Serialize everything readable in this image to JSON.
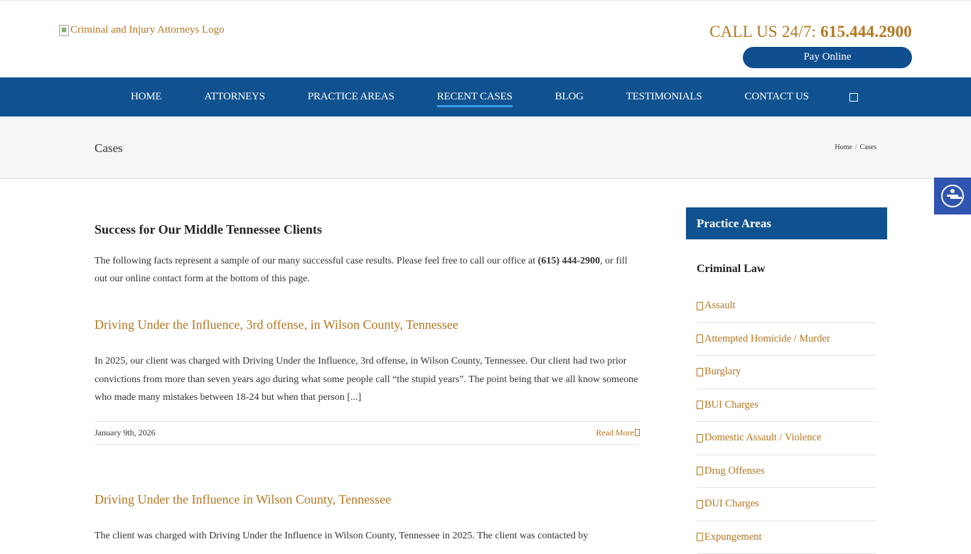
{
  "header": {
    "logo_alt": "Criminal and Injury Attorneys Logo",
    "call_label": "CALL US 24/7:",
    "phone": "615.444.2900",
    "pay_button": "Pay Online"
  },
  "nav": {
    "items": [
      "HOME",
      "ATTORNEYS",
      "PRACTICE AREAS",
      "RECENT CASES",
      "BLOG",
      "TESTIMONIALS",
      "CONTACT US"
    ],
    "active": "RECENT CASES",
    "search_glyph": ""
  },
  "titlebar": {
    "title": "Cases",
    "breadcrumb": [
      "Home",
      "Cases"
    ],
    "separator": "/"
  },
  "main": {
    "heading": "Success for Our Middle Tennessee Clients",
    "intro_before": "The following facts represent a sample of our many successful case results. Please feel free to call our office at ",
    "intro_phone": "(615) 444-2900",
    "intro_after": ", or fill out our online contact form at the bottom of this page.",
    "posts": [
      {
        "title": "Driving Under the Influence, 3rd offense, in Wilson County, Tennessee",
        "excerpt": "In 2025, our client was charged with Driving Under the Influence, 3rd offense, in Wilson County, Tennessee. Our client had two prior convictions from more than seven years ago during what some people call “the stupid years”. The point being that we all know someone who made many mistakes between 18-24 but when that person [...]",
        "date": "January 9th, 2026",
        "read_more": "Read More"
      },
      {
        "title": "Driving Under the Influence in Wilson County, Tennessee",
        "excerpt": "The client was charged with Driving Under the Influence in Wilson County, Tennessee in 2025. The client was contacted by"
      }
    ]
  },
  "sidebar": {
    "heading": "Practice Areas",
    "subheading": "Criminal Law",
    "items": [
      "Assault",
      "Attempted Homicide / Murder",
      "Burglary",
      "BUI Charges",
      "Domestic Assault / Violence",
      "Drug Offenses",
      "DUI Charges",
      "Expungement"
    ]
  },
  "colors": {
    "brand_blue": "#10528f",
    "accent_gold": "#b5761f",
    "active_underline": "#3d9ae8",
    "a11y_blue": "#2f55b0"
  },
  "icons": {
    "accessibility": "accessibility-icon",
    "search": "search-icon",
    "read_more": "chevron-right-icon",
    "list_bullet": "chevron-right-icon"
  }
}
